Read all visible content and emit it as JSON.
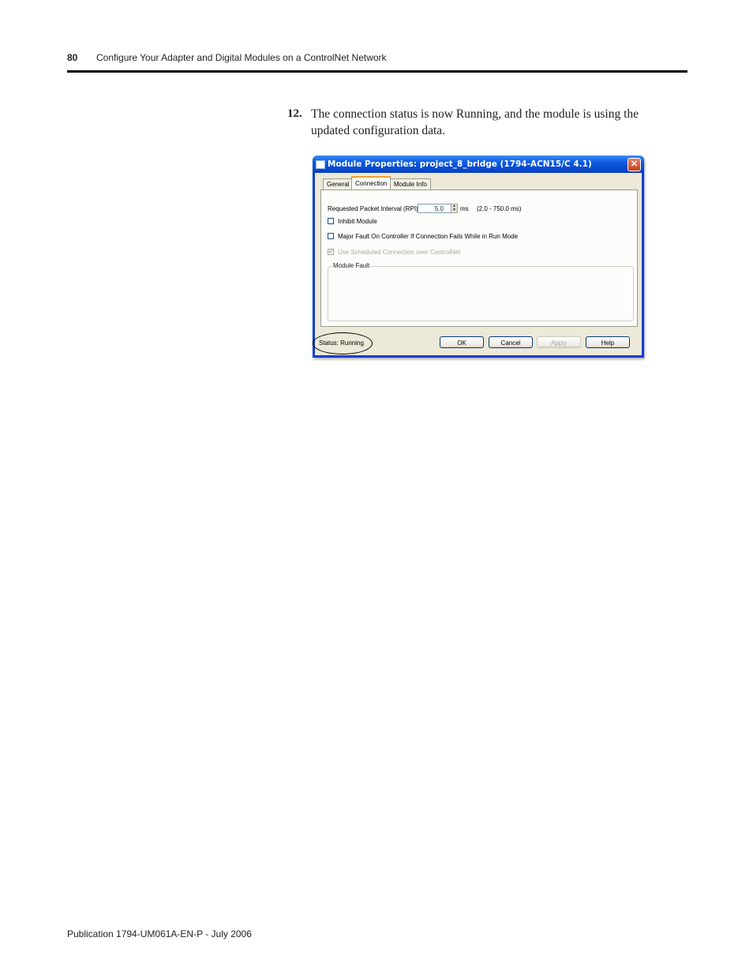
{
  "header": {
    "page_number": "80",
    "title": "Configure Your Adapter and Digital Modules on a ControlNet Network"
  },
  "step": {
    "number": "12.",
    "text": "The connection status is now Running, and the module is using the updated configuration data."
  },
  "dialog": {
    "title": "Module Properties: project_8_bridge (1794-ACN15/C 4.1)",
    "close_glyph": "✕",
    "tabs": [
      {
        "label": "General",
        "active": false
      },
      {
        "label": "Connection",
        "active": true
      },
      {
        "label": "Module Info",
        "active": false
      }
    ],
    "rpi": {
      "label": "Requested Packet Interval (RPI):",
      "value": "5.0",
      "unit": "ms",
      "range": "(2.0 - 750.0 ms)"
    },
    "checkboxes": [
      {
        "label": "Inhibit Module",
        "checked": false,
        "enabled": true
      },
      {
        "label": "Major Fault On Controller If Connection Fails While in Run Mode",
        "checked": false,
        "enabled": true
      },
      {
        "label": "Use Scheduled Connection over ControlNet",
        "checked": true,
        "enabled": false
      }
    ],
    "module_fault_title": "Module Fault",
    "status_text": "Status:  Running",
    "buttons": {
      "ok": "OK",
      "cancel": "Cancel",
      "apply": "Apply",
      "help": "Help"
    },
    "check_glyph": "✔",
    "spin_up": "▲",
    "spin_down": "▼"
  },
  "footer": {
    "publication": "Publication 1794-UM061A-EN-P - July 2006"
  }
}
